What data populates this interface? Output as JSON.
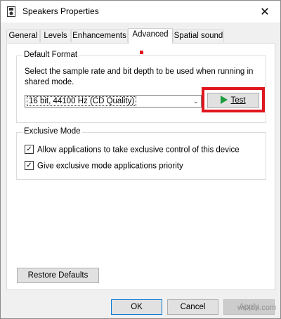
{
  "window": {
    "title": "Speakers Properties",
    "close_symbol": "✕"
  },
  "tabs": [
    {
      "label": "General"
    },
    {
      "label": "Levels"
    },
    {
      "label": "Enhancements"
    },
    {
      "label": "Advanced"
    },
    {
      "label": "Spatial sound"
    }
  ],
  "default_format": {
    "legend": "Default Format",
    "description": "Select the sample rate and bit depth to be used when running in shared mode.",
    "selected_format": "16 bit, 44100 Hz (CD Quality)",
    "test_label": "Test"
  },
  "exclusive_mode": {
    "legend": "Exclusive Mode",
    "options": [
      {
        "label": "Allow applications to take exclusive control of this device",
        "checked": true
      },
      {
        "label": "Give exclusive mode applications priority",
        "checked": true
      }
    ]
  },
  "buttons": {
    "restore": "Restore Defaults",
    "ok": "OK",
    "cancel": "Cancel",
    "apply": "Apply"
  },
  "watermark": "wsxdn.com",
  "colors": {
    "highlight": "#e0161e",
    "play_icon": "#1e9b3d"
  }
}
